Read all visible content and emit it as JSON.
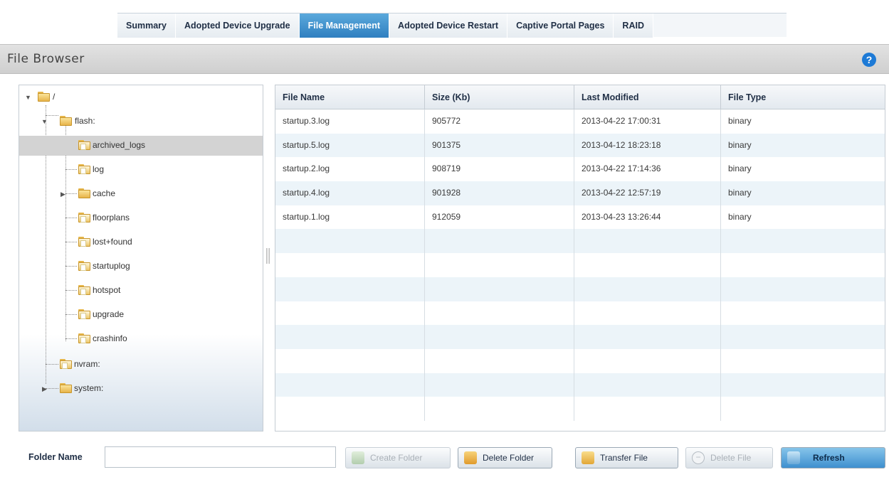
{
  "tabs": [
    {
      "label": "Summary",
      "active": false
    },
    {
      "label": "Adopted Device Upgrade",
      "active": false
    },
    {
      "label": "File Management",
      "active": true
    },
    {
      "label": "Adopted Device Restart",
      "active": false
    },
    {
      "label": "Captive Portal Pages",
      "active": false
    },
    {
      "label": "RAID",
      "active": false
    }
  ],
  "header": {
    "title": "File Browser",
    "help_icon": "help-icon"
  },
  "tree": {
    "items": [
      {
        "label": "/",
        "depth": 0,
        "expander": "expanded",
        "icon": "folder-icon"
      },
      {
        "label": "flash:",
        "depth": 1,
        "expander": "expanded",
        "icon": "folder-icon"
      },
      {
        "label": "archived_logs",
        "depth": 2,
        "expander": "none",
        "icon": "folder-doc-icon",
        "selected": true
      },
      {
        "label": "log",
        "depth": 2,
        "expander": "none",
        "icon": "folder-doc-icon"
      },
      {
        "label": "cache",
        "depth": 2,
        "expander": "collapsed",
        "icon": "folder-icon"
      },
      {
        "label": "floorplans",
        "depth": 2,
        "expander": "none",
        "icon": "folder-doc-icon"
      },
      {
        "label": "lost+found",
        "depth": 2,
        "expander": "none",
        "icon": "folder-doc-icon"
      },
      {
        "label": "startuplog",
        "depth": 2,
        "expander": "none",
        "icon": "folder-doc-icon"
      },
      {
        "label": "hotspot",
        "depth": 2,
        "expander": "none",
        "icon": "folder-doc-icon"
      },
      {
        "label": "upgrade",
        "depth": 2,
        "expander": "none",
        "icon": "folder-doc-icon"
      },
      {
        "label": "crashinfo",
        "depth": 2,
        "expander": "none",
        "icon": "folder-doc-icon"
      },
      {
        "label": "nvram:",
        "depth": 1,
        "expander": "none",
        "icon": "folder-doc-icon"
      },
      {
        "label": "system:",
        "depth": 1,
        "expander": "collapsed",
        "icon": "folder-icon"
      }
    ]
  },
  "grid": {
    "columns": [
      "File Name",
      "Size (Kb)",
      "Last Modified",
      "File Type"
    ],
    "rows": [
      [
        "startup.3.log",
        "905772",
        "2013-04-22 17:00:31",
        "binary"
      ],
      [
        "startup.5.log",
        "901375",
        "2013-04-12 18:23:18",
        "binary"
      ],
      [
        "startup.2.log",
        "908719",
        "2013-04-22 17:14:36",
        "binary"
      ],
      [
        "startup.4.log",
        "901928",
        "2013-04-22 12:57:19",
        "binary"
      ],
      [
        "startup.1.log",
        "912059",
        "2013-04-23 13:26:44",
        "binary"
      ]
    ],
    "empty_rows": 8
  },
  "footer": {
    "folder_name_label": "Folder Name",
    "folder_name_value": "",
    "buttons": {
      "create_folder": "Create Folder",
      "delete_folder": "Delete Folder",
      "transfer_file": "Transfer File",
      "delete_file": "Delete File",
      "refresh": "Refresh"
    }
  },
  "colors": {
    "accent": "#2f7fc0",
    "tab_active_top": "#5ba9dc",
    "selection": "#d3d3d3",
    "grid_stripe": "#ecf4f9"
  }
}
